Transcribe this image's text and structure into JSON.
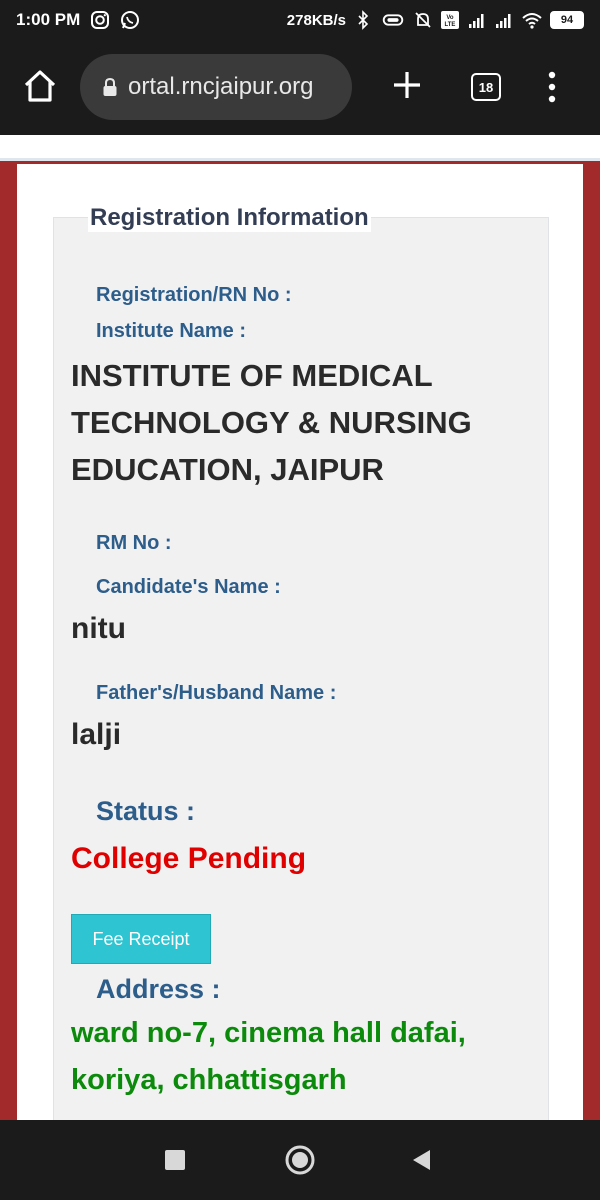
{
  "status_bar": {
    "time": "1:00 PM",
    "network_speed": "278KB/s",
    "battery": "94"
  },
  "browser": {
    "url": "ortal.rncjaipur.org",
    "tab_count": "18"
  },
  "page": {
    "header_stub": "",
    "section_title": "Registration Information",
    "registration_label": "Registration/RN No :",
    "institute_label": "Institute Name :",
    "institute_value": "INSTITUTE OF MEDICAL TECHNOLOGY & NURSING EDUCATION, JAIPUR",
    "rm_label": "RM No :",
    "candidate_label": "Candidate's Name :",
    "candidate_value": "nitu",
    "father_label": "Father's/Husband Name :",
    "father_value": "lalji",
    "status_label": "Status :",
    "status_value": "College Pending",
    "fee_button": "Fee Receipt",
    "address_label": "Address :",
    "address_value": "ward no-7, cinema hall dafai, koriya, chhattisgarh"
  },
  "colors": {
    "status_pending": "#e00000",
    "address_green": "#0b8a0b",
    "label_blue": "#2d5d8a",
    "button_cyan": "#2ec4d1",
    "side_red": "#a22a2a"
  }
}
